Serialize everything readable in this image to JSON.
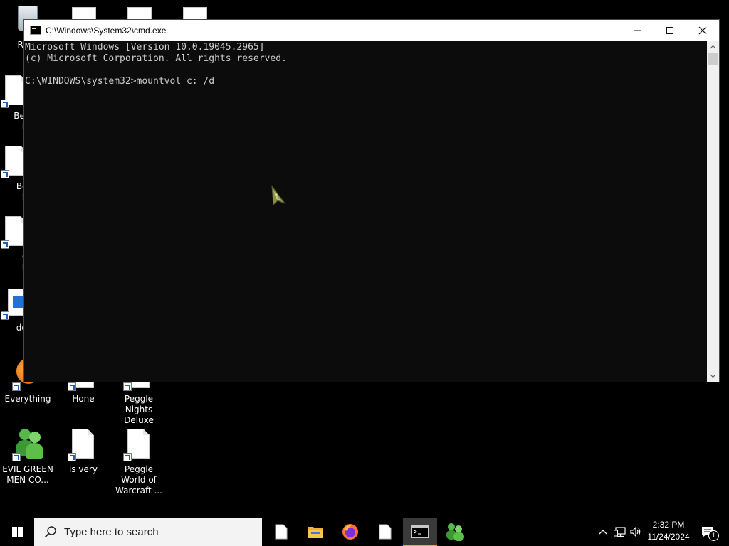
{
  "desktop": {
    "icons": [
      {
        "label": "Recycle Bin"
      },
      {
        "label": "Bejeweled Deluxe"
      },
      {
        "label": "Bejeweled Deluxe"
      },
      {
        "label": "Chuzzle Deluxe"
      },
      {
        "label": "does"
      },
      {
        "label": "Everything"
      },
      {
        "label": "Hone"
      },
      {
        "label": "Peggle Nights Deluxe"
      },
      {
        "label": "EVIL GREEN MEN CO..."
      },
      {
        "label": "is very"
      },
      {
        "label": "Peggle World of Warcraft ..."
      }
    ],
    "visible_labels": {
      "recycle": "Recy",
      "bej1_a": "Bejev",
      "bej1_b": "De",
      "bej2_a": "Beje",
      "bej2_b": "De",
      "chu_a": "Ch",
      "chu_b": "De",
      "does": "does"
    }
  },
  "cmd_window": {
    "title": "C:\\Windows\\System32\\cmd.exe",
    "minimize_glyph": "—",
    "maximize_glyph": "☐",
    "close_glyph": "✕",
    "console_lines": [
      "Microsoft Windows [Version 10.0.19045.2965]",
      "(c) Microsoft Corporation. All rights reserved.",
      "",
      "C:\\WINDOWS\\system32>mountvol c: /d"
    ]
  },
  "taskbar": {
    "search_placeholder": "Type here to search",
    "apps": [
      {
        "name": "file-app",
        "active": false
      },
      {
        "name": "file-explorer",
        "active": false
      },
      {
        "name": "firefox",
        "active": false
      },
      {
        "name": "file-app-2",
        "active": false
      },
      {
        "name": "command-prompt",
        "active": true
      },
      {
        "name": "evil-green-men",
        "active": false
      }
    ],
    "clock": {
      "time": "2:32 PM",
      "date": "11/24/2024"
    },
    "notification_count": "1",
    "colors": {
      "active_indicator": "#e9a13b",
      "search_bg": "#f3f3f3"
    }
  }
}
